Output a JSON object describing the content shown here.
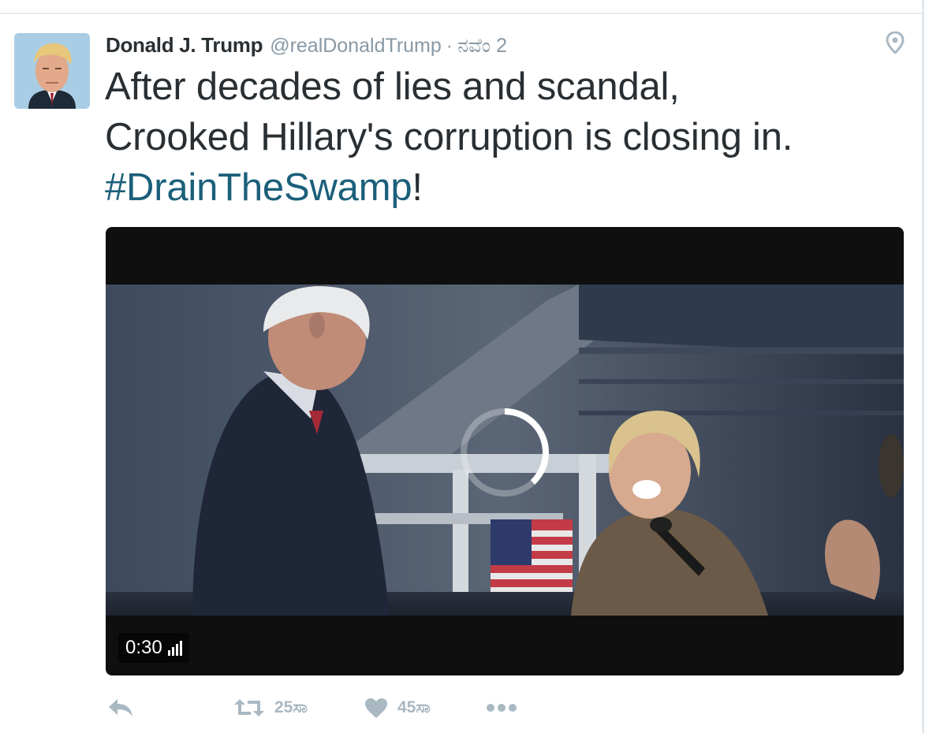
{
  "tweet": {
    "author_name": "Donald J. Trump",
    "handle": "@realDonaldTrump",
    "separator": "·",
    "timestamp": "ನವೆಂ 2",
    "text_line1": "After decades of lies and scandal,",
    "text_line2": "Crooked Hillary's corruption is closing in.",
    "hashtag": "#DrainTheSwamp",
    "text_suffix": "!"
  },
  "media": {
    "duration": "0:30",
    "loading_progress": 0.38
  },
  "actions": {
    "reply_count": "",
    "retweet_count": "25ಸಾ",
    "like_count": "45ಸಾ"
  },
  "colors": {
    "text": "#292f33",
    "muted": "#8899a6",
    "hashtag": "#1b5f7a",
    "action_icon": "#aab8c2"
  },
  "icons": [
    "location-pin-icon",
    "reply-icon",
    "retweet-icon",
    "heart-icon",
    "more-icon",
    "volume-bars-icon",
    "loading-spinner"
  ]
}
